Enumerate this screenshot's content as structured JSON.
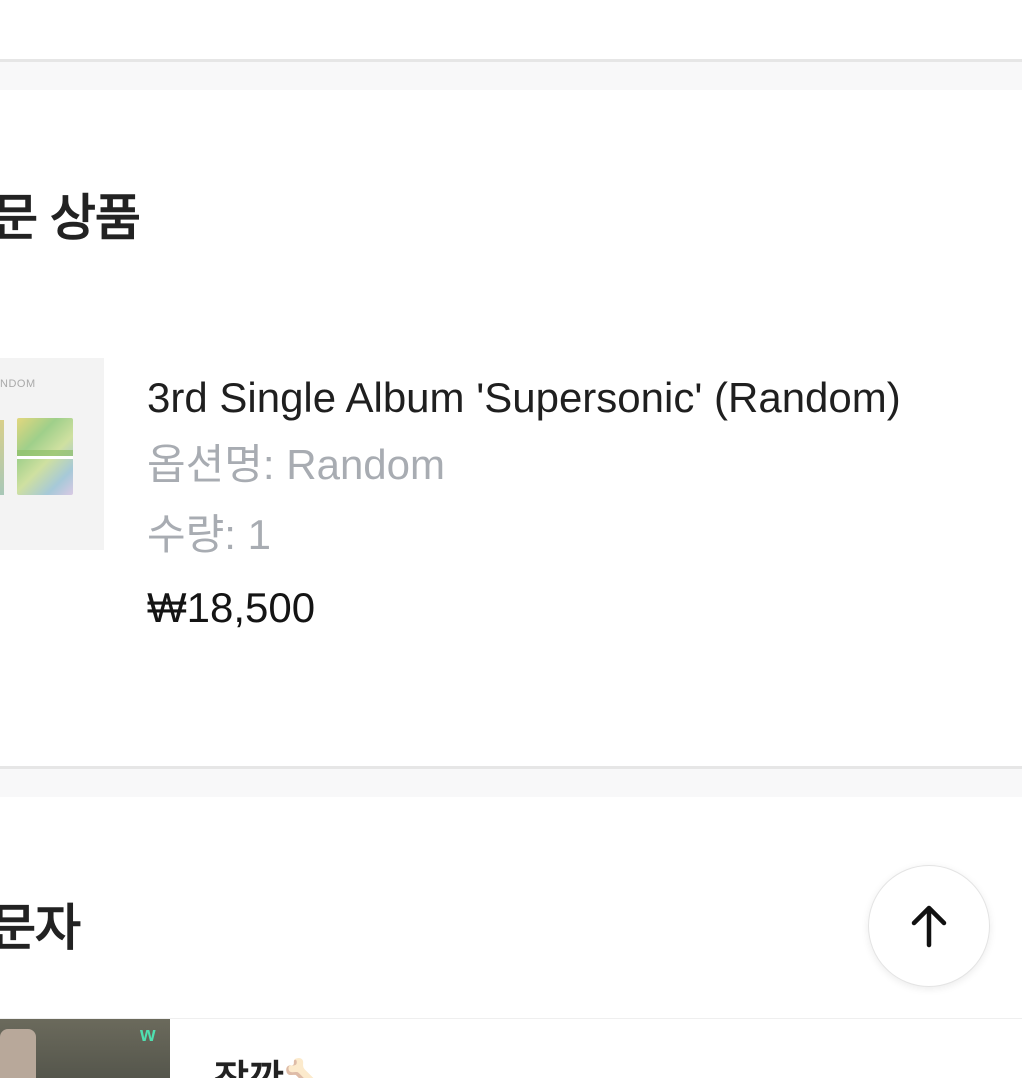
{
  "ordered_products": {
    "title": "문 상품",
    "item": {
      "thumbnail_text": "NDOM",
      "name": "3rd Single Album 'Supersonic' (Random)",
      "option": "옵션명: Random",
      "quantity": "수량: 1",
      "price": "₩18,500"
    }
  },
  "second_section": {
    "title": "문자"
  },
  "post": {
    "title": "잠깐🦴",
    "thumbnail_logo": "w"
  },
  "scroll_top": {
    "icon": "arrow-up-icon"
  }
}
